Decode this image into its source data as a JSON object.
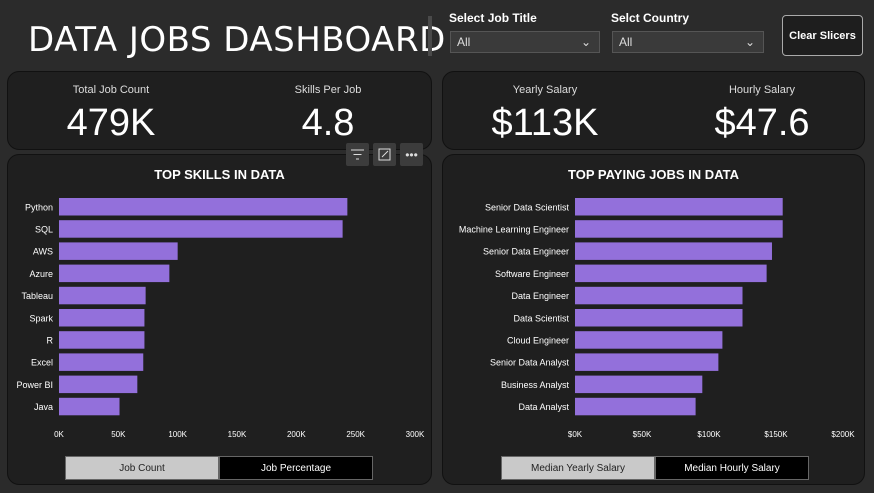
{
  "header": {
    "title": "DATA JOBS DASHBOARD",
    "clear_label": "Clear Slicers"
  },
  "slicers": [
    {
      "label": "Select Job Title",
      "value": "All"
    },
    {
      "label": "Selct Country",
      "value": "All"
    }
  ],
  "kpis_left": [
    {
      "label": "Total Job Count",
      "value": "479K"
    },
    {
      "label": "Skills Per Job",
      "value": "4.8"
    }
  ],
  "kpis_right": [
    {
      "label": "Yearly Salary",
      "value": "$113K"
    },
    {
      "label": "Hourly Salary",
      "value": "$47.6"
    }
  ],
  "toggles_left": [
    "Job Count",
    "Job Percentage"
  ],
  "toggles_right": [
    "Median Yearly Salary",
    "Median Hourly Salary"
  ],
  "colors": {
    "bar": "#9370DB",
    "panel": "#1f1f1f"
  },
  "toolbar_icons": [
    "filter-icon",
    "focus-mode-icon",
    "more-options-icon"
  ],
  "chart_data": [
    {
      "type": "bar",
      "orientation": "horizontal",
      "title": "TOP SKILLS IN DATA",
      "categories": [
        "Python",
        "SQL",
        "AWS",
        "Azure",
        "Tableau",
        "Spark",
        "R",
        "Excel",
        "Power BI",
        "Java"
      ],
      "values": [
        243000,
        239000,
        100000,
        93000,
        73000,
        72000,
        72000,
        71000,
        66000,
        51000
      ],
      "xlim": [
        0,
        300000
      ],
      "ticks": [
        "0K",
        "50K",
        "100K",
        "150K",
        "200K",
        "250K",
        "300K"
      ]
    },
    {
      "type": "bar",
      "orientation": "horizontal",
      "title": "TOP PAYING JOBS IN DATA",
      "categories": [
        "Senior Data Scientist",
        "Machine Learning Engineer",
        "Senior Data Engineer",
        "Software Engineer",
        "Data Engineer",
        "Data Scientist",
        "Cloud Engineer",
        "Senior Data Analyst",
        "Business Analyst",
        "Data Analyst"
      ],
      "values": [
        155000,
        155000,
        147000,
        143000,
        125000,
        125000,
        110000,
        107000,
        95000,
        90000
      ],
      "xlim": [
        0,
        200000
      ],
      "ticks": [
        "$0K",
        "$50K",
        "$100K",
        "$150K",
        "$200K"
      ]
    }
  ]
}
